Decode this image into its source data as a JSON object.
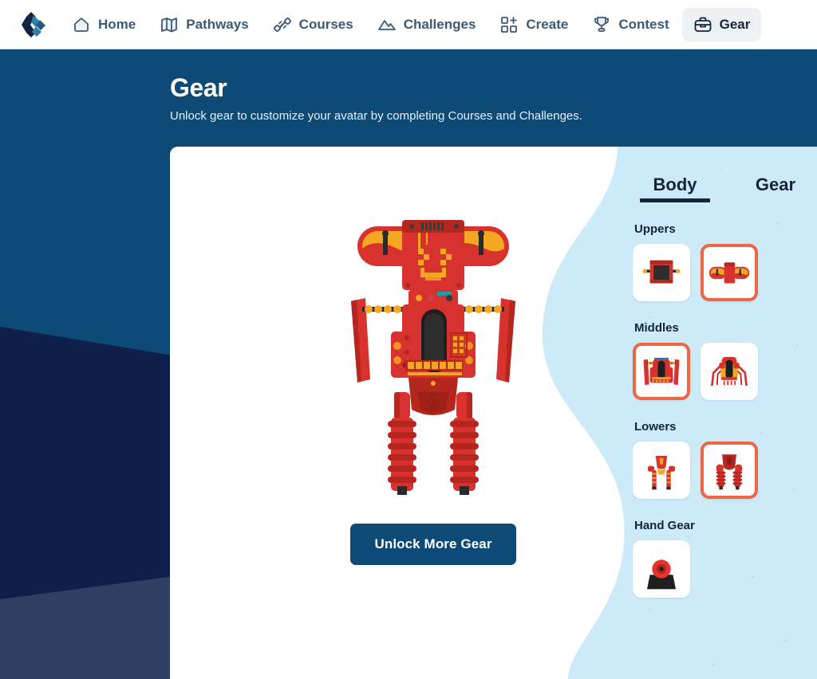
{
  "colors": {
    "header_blue": "#0d4a76",
    "deco_navy": "#0d1f4a",
    "deco_slate": "#2d3f63",
    "panel_light_blue": "#cdeaf9",
    "accent_orange": "#f06543",
    "text_navy": "#14243c",
    "nav_text": "#3b5a73",
    "robot_red": "#d8322e",
    "robot_yellow": "#f5a623"
  },
  "navbar": {
    "logo_name": "codeverse-logo",
    "items": [
      {
        "label": "Home",
        "icon": "home-icon",
        "active": false
      },
      {
        "label": "Pathways",
        "icon": "map-icon",
        "active": false
      },
      {
        "label": "Courses",
        "icon": "dumbbell-icon",
        "active": false
      },
      {
        "label": "Challenges",
        "icon": "mountain-icon",
        "active": false
      },
      {
        "label": "Create",
        "icon": "grid-plus-icon",
        "active": false
      },
      {
        "label": "Contest",
        "icon": "trophy-icon",
        "active": false
      },
      {
        "label": "Gear",
        "icon": "briefcase-icon",
        "active": true
      }
    ]
  },
  "header": {
    "title": "Gear",
    "subtitle": "Unlock gear to customize your avatar by completing Courses and Challenges."
  },
  "main": {
    "unlock_button": "Unlock More Gear",
    "avatar_name": "robot-avatar"
  },
  "panel": {
    "tabs": [
      {
        "label": "Body",
        "active": true
      },
      {
        "label": "Gear",
        "active": false
      }
    ],
    "groups": [
      {
        "title": "Uppers",
        "items": [
          {
            "name": "upper-option-1",
            "selected": false,
            "art": "upper-box"
          },
          {
            "name": "upper-option-2",
            "selected": true,
            "art": "upper-wings"
          }
        ]
      },
      {
        "title": "Middles",
        "items": [
          {
            "name": "middle-option-1",
            "selected": true,
            "art": "middle-bar"
          },
          {
            "name": "middle-option-2",
            "selected": false,
            "art": "middle-spider"
          }
        ]
      },
      {
        "title": "Lowers",
        "items": [
          {
            "name": "lower-option-1",
            "selected": false,
            "art": "lower-thin"
          },
          {
            "name": "lower-option-2",
            "selected": true,
            "art": "lower-coil"
          }
        ]
      },
      {
        "title": "Hand Gear",
        "items": [
          {
            "name": "hand-gear-option-1",
            "selected": false,
            "art": "hand-disc"
          }
        ]
      }
    ]
  }
}
